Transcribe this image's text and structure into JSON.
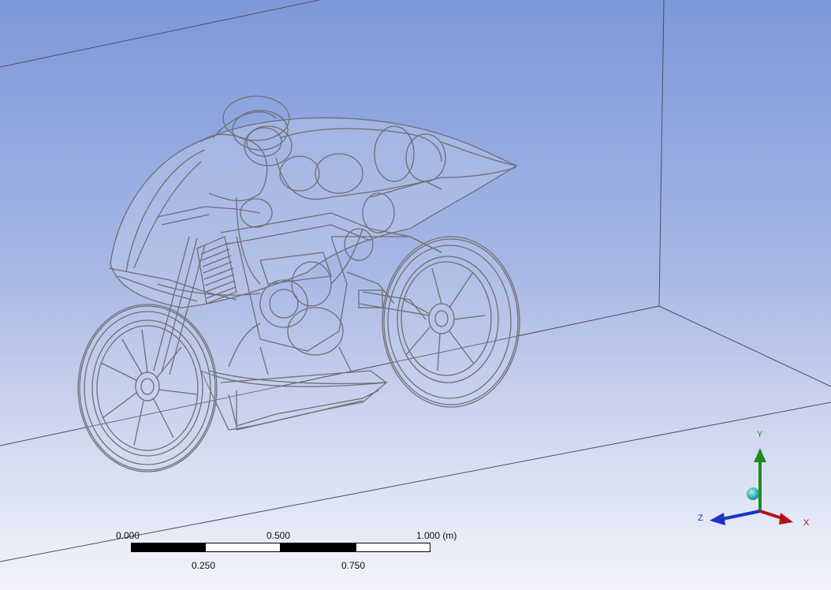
{
  "viewport": {
    "background_top": "#7d98da",
    "background_bottom": "#f3f4fa",
    "model": "motorcycle-wireframe-in-enclosure"
  },
  "scale_bar": {
    "labels_top": [
      "0.000",
      "0.500",
      "1.000 (m)"
    ],
    "labels_bottom": [
      "0.250",
      "0.750"
    ]
  },
  "triad": {
    "y_label": "Y",
    "z_label": "Z",
    "x_label": "X",
    "y_color": "#1f8a1f",
    "z_color": "#1a34c8",
    "x_color": "#b01515",
    "sphere_color": "#20b2aa"
  }
}
